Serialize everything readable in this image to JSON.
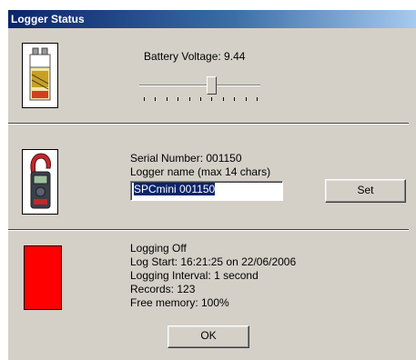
{
  "window": {
    "title": "Logger Status"
  },
  "battery": {
    "voltage_text": "Battery Voltage: 9.44",
    "slider_value_fraction": 0.6,
    "tick_count": 11
  },
  "logger": {
    "serial_text": "Serial Number: 001150",
    "name_label": "Logger name (max 14 chars)",
    "name_value": "SPCmini 001150",
    "set_label": "Set"
  },
  "status": {
    "indicator_color": "#ff0000",
    "lines": [
      "Logging Off",
      "Log Start: 16:21:25 on 22/06/2006",
      "Logging Interval: 1 second",
      "Records: 123",
      "Free memory: 100%"
    ],
    "ok_label": "OK"
  },
  "icons": [
    "battery-icon",
    "clamp-meter-icon"
  ]
}
